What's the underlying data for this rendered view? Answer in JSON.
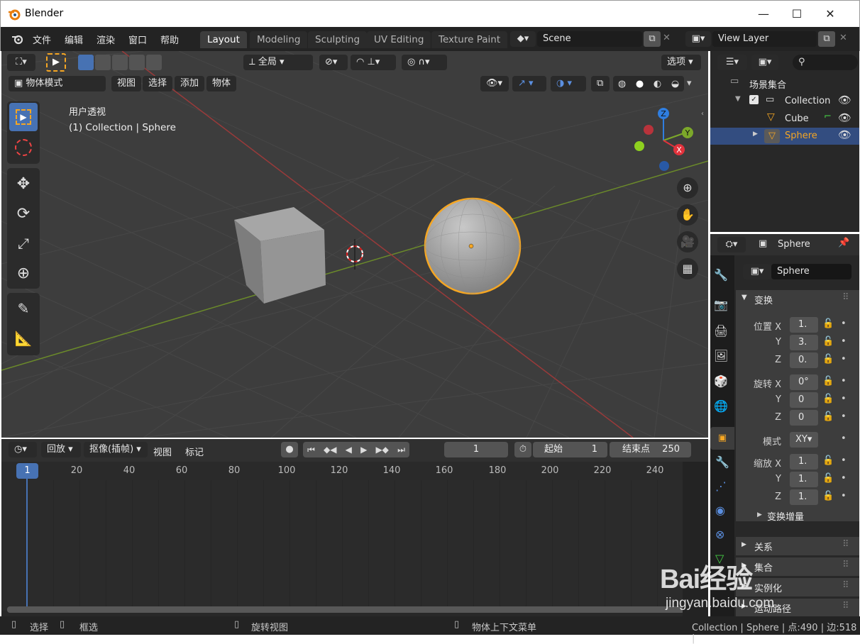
{
  "window": {
    "title": "Blender",
    "minimize": "—",
    "maximize": "☐",
    "close": "✕"
  },
  "menu": [
    "文件",
    "编辑",
    "渲染",
    "窗口",
    "帮助"
  ],
  "workspaces": [
    "Layout",
    "Modeling",
    "Sculpting",
    "UV Editing",
    "Texture Paint"
  ],
  "scene": {
    "value": "Scene"
  },
  "view_layer": {
    "value": "View Layer"
  },
  "viewport": {
    "header": {
      "transform_orientation": "全局",
      "options": "选项",
      "mode": "物体模式",
      "menus": [
        "视图",
        "选择",
        "添加",
        "物体"
      ]
    },
    "overlay_text": {
      "view_name": "用户透视",
      "collection_info": "(1) Collection | Sphere"
    },
    "gizmo": {
      "z": "Z",
      "y": "Y",
      "x": "X"
    }
  },
  "timeline": {
    "menus": [
      "回放",
      "抠像(插帧)",
      "视图",
      "标记"
    ],
    "current_frame": "1",
    "start_label": "起始",
    "start_value": "1",
    "end_label": "结束点",
    "end_value": "250",
    "ruler": [
      "1",
      "20",
      "40",
      "60",
      "80",
      "100",
      "120",
      "140",
      "160",
      "180",
      "200",
      "220",
      "240"
    ]
  },
  "outliner": {
    "root": "场景集合",
    "items": [
      {
        "label": "Collection"
      },
      {
        "label": "Cube"
      },
      {
        "label": "Sphere"
      }
    ]
  },
  "properties": {
    "header_object": "Sphere",
    "object_name": "Sphere",
    "panel_transform": "变换",
    "location": {
      "label": "位置",
      "x": "1.",
      "y": "3.",
      "z": "0."
    },
    "rotation": {
      "label": "旋转",
      "x": "0°",
      "y": "0",
      "z": "0"
    },
    "mode": {
      "label": "模式",
      "value": "XY"
    },
    "scale": {
      "label": "缩放",
      "x": "1.",
      "y": "1.",
      "z": "1."
    },
    "axis": {
      "x": "X",
      "y": "Y",
      "z": "Z"
    },
    "subpanels": [
      "变换增量",
      "关系",
      "集合",
      "实例化",
      "运动路径"
    ]
  },
  "status": {
    "select": "选择",
    "box_select": "框选",
    "rotate_view": "旋转视图",
    "context_menu": "物体上下文菜单",
    "stats": "Collection | Sphere | 点:490 | 边:518 |"
  },
  "watermark": {
    "brand": "Bai经验",
    "url": "jingyan.baidu.com"
  },
  "colors": {
    "accent": "#4772b3",
    "selected": "#f5a623",
    "bg": "#3d3d3d"
  }
}
